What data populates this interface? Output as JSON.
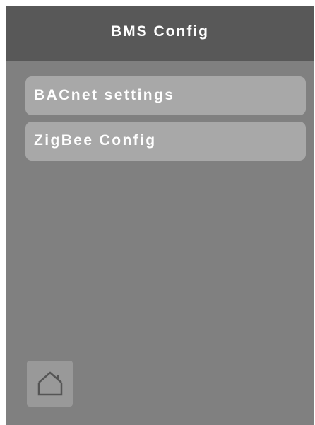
{
  "header": {
    "title": "BMS Config"
  },
  "menu": {
    "items": [
      {
        "label": "BACnet settings"
      },
      {
        "label": "ZigBee Config"
      }
    ]
  },
  "footer": {
    "home_icon": "home-icon"
  },
  "colors": {
    "screen_background": "#808080",
    "header_background": "#585858",
    "menu_item_background": "#a8a8a8",
    "home_button_background": "#999999",
    "text": "#ffffff",
    "icon_stroke": "#555555"
  }
}
